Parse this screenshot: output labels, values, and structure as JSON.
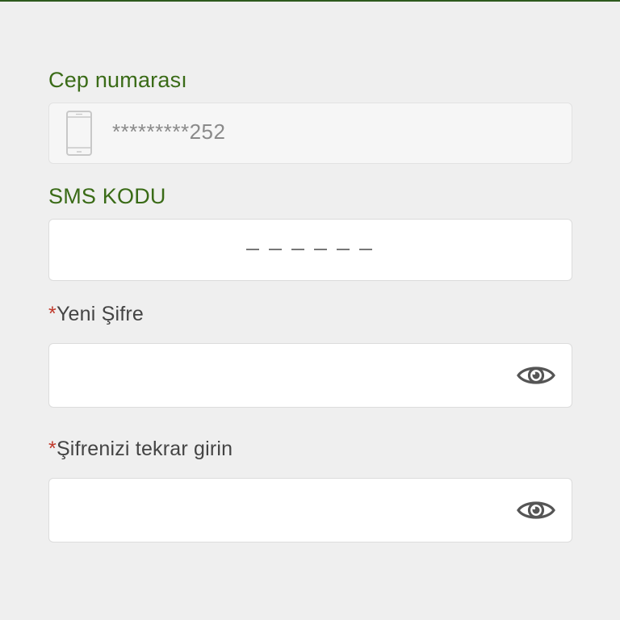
{
  "colors": {
    "accent_green": "#3a6b17",
    "required_red": "#c0392b",
    "link_blue": "#1f3aa6"
  },
  "phone": {
    "label": "Cep numarası",
    "value": "*********252",
    "icon": "phone-icon"
  },
  "sms": {
    "label": "SMS KODU",
    "placeholder": "_ _ _ _ _ _"
  },
  "new_password": {
    "required_mark": "*",
    "label": "Yeni Şifre",
    "icon": "eye-icon"
  },
  "confirm_password": {
    "required_mark": "*",
    "label": "Şifrenizi tekrar girin",
    "icon": "eye-icon"
  }
}
